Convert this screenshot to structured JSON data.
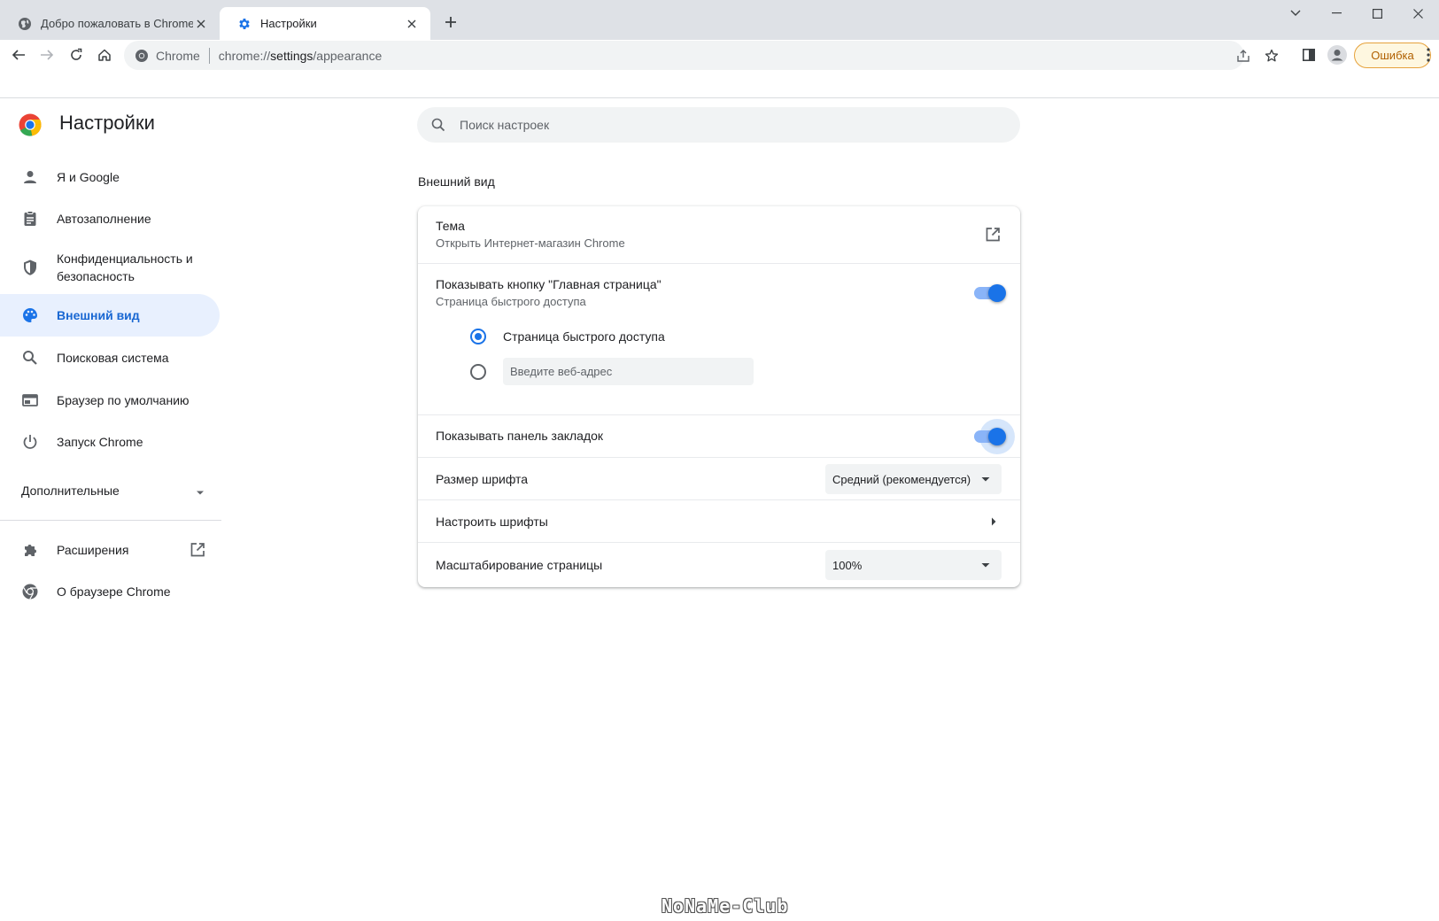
{
  "tabs": [
    {
      "title": "Добро пожаловать в Chrome!",
      "icon": "chrome-globe-icon",
      "active": false
    },
    {
      "title": "Настройки",
      "icon": "gear-icon",
      "active": true
    }
  ],
  "toolbar": {
    "chip_label": "Chrome",
    "url_scheme": "chrome://",
    "url_host": "settings",
    "url_path": "/appearance",
    "error_label": "Ошибка"
  },
  "header": {
    "title": "Настройки",
    "search_placeholder": "Поиск настроек"
  },
  "sidebar": {
    "items": [
      {
        "label": "Я и Google",
        "icon": "person-icon"
      },
      {
        "label": "Автозаполнение",
        "icon": "clipboard-icon"
      },
      {
        "label": "Конфиденциальность и безопасность",
        "icon": "shield-icon"
      },
      {
        "label": "Внешний вид",
        "icon": "palette-icon",
        "selected": true
      },
      {
        "label": "Поисковая система",
        "icon": "search-icon"
      },
      {
        "label": "Браузер по умолчанию",
        "icon": "browser-window-icon"
      },
      {
        "label": "Запуск Chrome",
        "icon": "power-icon"
      }
    ],
    "advanced_label": "Дополнительные",
    "bottom_items": [
      {
        "label": "Расширения",
        "icon": "puzzle-icon"
      },
      {
        "label": "О браузере Chrome",
        "icon": "chrome-icon"
      }
    ]
  },
  "main": {
    "section_title": "Внешний вид",
    "theme": {
      "title": "Тема",
      "subtitle": "Открыть Интернет-магазин Chrome"
    },
    "home_button": {
      "title": "Показывать кнопку \"Главная страница\"",
      "subtitle": "Страница быстрого доступа",
      "enabled": true,
      "radio_ntp_label": "Страница быстрого доступа",
      "radio_custom_placeholder": "Введите веб-адрес",
      "selected": "ntp"
    },
    "bookmarks_bar": {
      "title": "Показывать панель закладок",
      "enabled": true
    },
    "font_size": {
      "title": "Размер шрифта",
      "value": "Средний (рекомендуется)"
    },
    "customize_fonts": {
      "title": "Настроить шрифты"
    },
    "page_zoom": {
      "title": "Масштабирование страницы",
      "value": "100%"
    }
  },
  "colors": {
    "accent": "#1a73e8",
    "selected_bg": "#e8f0fe",
    "tabstrip": "#dee1e6"
  },
  "watermark": "NoNaMe-Club"
}
